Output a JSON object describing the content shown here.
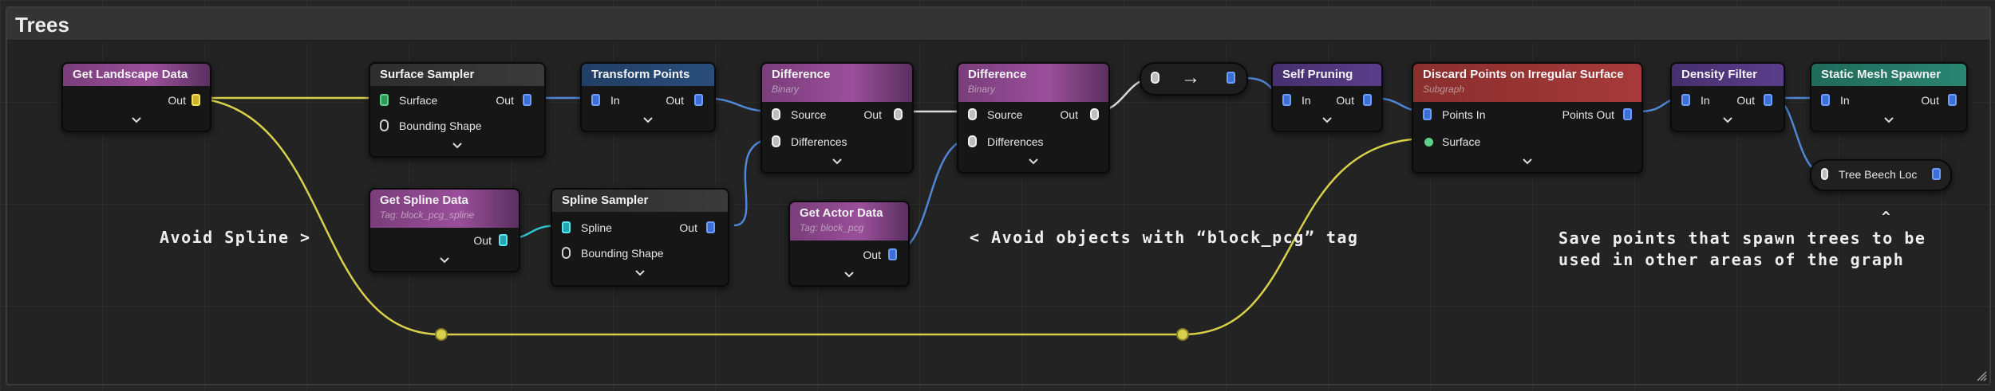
{
  "comment": {
    "title": "Trees"
  },
  "nodes": {
    "get_landscape": {
      "title": "Get Landscape Data",
      "out": "Out"
    },
    "surface_sampler": {
      "title": "Surface Sampler",
      "in": "Surface",
      "out": "Out",
      "shape": "Bounding Shape"
    },
    "transform_points": {
      "title": "Transform Points",
      "in": "In",
      "out": "Out"
    },
    "difference1": {
      "title": "Difference",
      "subtitle": "Binary",
      "source": "Source",
      "out": "Out",
      "diffs": "Differences"
    },
    "difference2": {
      "title": "Difference",
      "subtitle": "Binary",
      "source": "Source",
      "out": "Out",
      "diffs": "Differences"
    },
    "converter": {
      "arrow": "→"
    },
    "self_pruning": {
      "title": "Self Pruning",
      "in": "In",
      "out": "Out"
    },
    "discard_points": {
      "title": "Discard Points on Irregular Surface",
      "subtitle": "Subgraph",
      "in": "Points In",
      "out": "Points Out",
      "surface": "Surface"
    },
    "density_filter": {
      "title": "Density Filter",
      "in": "In",
      "out": "Out"
    },
    "static_mesh": {
      "title": "Static Mesh Spawner",
      "in": "In",
      "out": "Out"
    },
    "tree_beech": {
      "title": "Tree Beech Loc"
    },
    "get_spline": {
      "title": "Get Spline Data",
      "subtitle": "Tag: block_pcg_spline",
      "out": "Out"
    },
    "spline_sampler": {
      "title": "Spline Sampler",
      "in": "Spline",
      "out": "Out",
      "shape": "Bounding Shape"
    },
    "get_actor": {
      "title": "Get Actor Data",
      "subtitle": "Tag: block_pcg",
      "out": "Out"
    }
  },
  "notes": {
    "avoid_spline": "Avoid Spline >",
    "avoid_objects": "< Avoid objects with “block_pcg” tag",
    "save_points": "Save points that spawn trees to be\nused in other areas of the graph",
    "save_points_caret": "^"
  },
  "colors": {
    "wire_yellow": "#d8d04a",
    "wire_blue": "#4f86d6",
    "wire_white": "#dcdcdc"
  }
}
